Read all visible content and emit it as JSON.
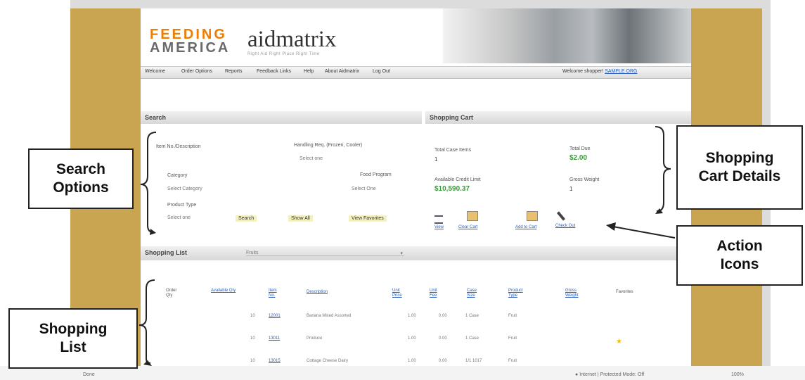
{
  "app": {
    "logo_feeding": "FEEDING",
    "logo_america": "AMERICA",
    "logo_aidmatrix": "aidmatrix",
    "logo_tagline": "Right Aid Right Place Right Time"
  },
  "nav": {
    "items": [
      "Welcome",
      "Order Options",
      "Reports",
      "Feedback Links",
      "Help",
      "About Aidmatrix",
      "Log Out"
    ],
    "welcome_text": "Welcome shopper!",
    "user_link": "SAMPLE ORG"
  },
  "search": {
    "title": "Search",
    "item_label": "Item No./Description",
    "handling_label": "Handling Req. (Frozen, Cooler)",
    "handling_value": "Select one",
    "category_label": "Category",
    "category_value": "Select Category",
    "food_program_label": "Food Program",
    "food_program_value": "Select One",
    "product_type_label": "Product Type",
    "product_type_value": "Select one",
    "search_button": "Search",
    "show_all_button": "Show All",
    "view_favorites_button": "View Favorites"
  },
  "cart": {
    "title": "Shopping Cart",
    "total_items_label": "Total Case Items",
    "total_items_value": "1",
    "total_due_label": "Total Due",
    "total_due_value": "$2.00",
    "credit_label": "Available Credit Limit",
    "credit_value": "$10,590.37",
    "gross_weight_label": "Gross Weight",
    "gross_weight_value": "1",
    "actions": [
      "View",
      "Clear Cart",
      "Add to Cart",
      "Check Out"
    ]
  },
  "list": {
    "title": "Shopping List",
    "filter_value": "Fruits",
    "columns": [
      "Order Qty",
      "Available Qty",
      "Item No.",
      "Description",
      "Unit Price",
      "Unit Fee",
      "Case Size",
      "Product Type",
      "Gross Weight",
      "Favorites"
    ],
    "rows": [
      {
        "qty": "",
        "avail": "10",
        "item": "12001",
        "desc": "Banana Mixed Assorted",
        "price": "1.00",
        "fee": "0.00",
        "size": "1 Case",
        "type": "Fruit",
        "weight": "",
        "fav": false
      },
      {
        "qty": "",
        "avail": "10",
        "item": "13011",
        "desc": "Produce",
        "price": "1.00",
        "fee": "0.00",
        "size": "1 Case",
        "type": "Fruit",
        "weight": "",
        "fav": true
      },
      {
        "qty": "",
        "avail": "10",
        "item": "13015",
        "desc": "Cottage Cheese Dairy",
        "price": "1.00",
        "fee": "0.00",
        "size": "1/1 1017",
        "type": "Fruit",
        "weight": "",
        "fav": false
      }
    ]
  },
  "callouts": {
    "search_options": "Search Options",
    "cart_details": "Shopping Cart Details",
    "action_icons": "Action Icons",
    "shopping_list": "Shopping List"
  },
  "statusbar": {
    "left": "Done",
    "zone": "Internet | Protected Mode: Off",
    "zoom": "100%"
  },
  "colors": {
    "gold": "#c9a451",
    "orange": "#ee7d00",
    "green": "#3a9a3a",
    "link": "#2a5fbf"
  }
}
